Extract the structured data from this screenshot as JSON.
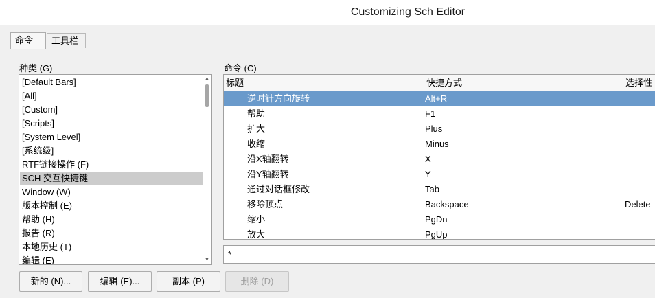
{
  "window": {
    "title": "Customizing Sch Editor"
  },
  "tabs": [
    {
      "label": "命令"
    },
    {
      "label": "工具栏"
    }
  ],
  "categories": {
    "label": "种类 (G)",
    "items": [
      {
        "label": "[Default Bars]"
      },
      {
        "label": "[All]"
      },
      {
        "label": "[Custom]"
      },
      {
        "label": "[Scripts]"
      },
      {
        "label": "[System Level]"
      },
      {
        "label": "[系统级]"
      },
      {
        "label": "RTF链接操作 (F)"
      },
      {
        "label": "SCH 交互快捷键"
      },
      {
        "label": "Window (W)"
      },
      {
        "label": "版本控制 (E)"
      },
      {
        "label": "帮助 (H)"
      },
      {
        "label": "报告 (R)"
      },
      {
        "label": "本地历史 (T)"
      },
      {
        "label": "编辑 (E)"
      }
    ],
    "selected_index": 7
  },
  "commands": {
    "label": "命令 (C)",
    "columns": [
      "标题",
      "快捷方式",
      "选择性"
    ],
    "rows": [
      {
        "title": "逆时针方向旋转",
        "shortcut": "Alt+R",
        "alt": ""
      },
      {
        "title": "帮助",
        "shortcut": "F1",
        "alt": ""
      },
      {
        "title": "扩大",
        "shortcut": "Plus",
        "alt": ""
      },
      {
        "title": "收缩",
        "shortcut": "Minus",
        "alt": ""
      },
      {
        "title": "沿X轴翻转",
        "shortcut": "X",
        "alt": ""
      },
      {
        "title": "沿Y轴翻转",
        "shortcut": "Y",
        "alt": ""
      },
      {
        "title": "通过对话框修改",
        "shortcut": "Tab",
        "alt": ""
      },
      {
        "title": "移除顶点",
        "shortcut": "Backspace",
        "alt": "Delete"
      },
      {
        "title": "缩小",
        "shortcut": "PgDn",
        "alt": ""
      },
      {
        "title": "放大",
        "shortcut": "PgUp",
        "alt": ""
      }
    ],
    "selected_index": 0
  },
  "filter": {
    "value": "*"
  },
  "buttons": {
    "new": "新的 (N)...",
    "edit": "编辑 (E)...",
    "copy": "副本 (P)",
    "delete": "删除 (D)"
  },
  "scrollbar": {
    "up_arrow": "▲",
    "down_arrow": "▼"
  }
}
